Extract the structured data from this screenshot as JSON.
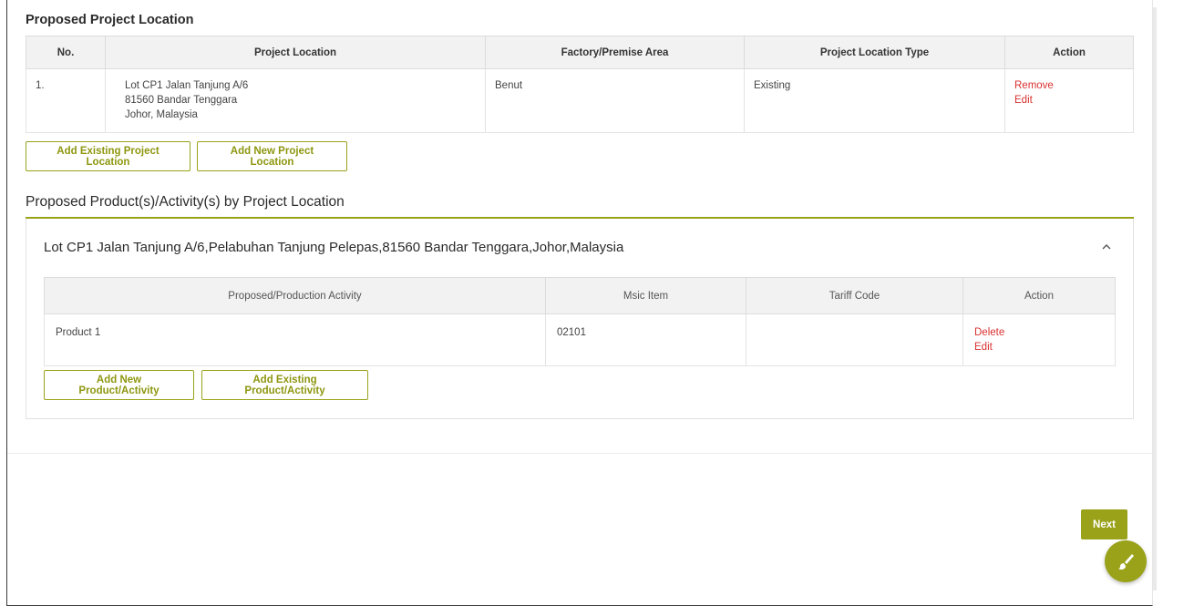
{
  "colors": {
    "accent": "#9aa21a",
    "danger": "#d9302f"
  },
  "project_location": {
    "title": "Proposed Project Location",
    "columns": [
      "No.",
      "Project Location",
      "Factory/Premise Area",
      "Project Location Type",
      "Action"
    ],
    "rows": [
      {
        "no": "1.",
        "location_line1": "Lot CP1 Jalan Tanjung A/6",
        "location_line2": "81560 Bandar Tenggara",
        "location_line3": "Johor, Malaysia",
        "area": "Benut",
        "type": "Existing",
        "remove": "Remove",
        "edit": "Edit"
      }
    ],
    "add_existing_label": "Add Existing Project Location",
    "add_new_label": "Add New Project Location"
  },
  "products": {
    "title": "Proposed Product(s)/Activity(s) by Project Location",
    "panel": {
      "title": "Lot CP1 Jalan Tanjung A/6,Pelabuhan Tanjung Pelepas,81560 Bandar Tenggara,Johor,Malaysia",
      "icon": "chevron-up-icon",
      "columns": [
        "Proposed/Production Activity",
        "Msic Item",
        "Tariff Code",
        "Action"
      ],
      "rows": [
        {
          "activity": "Product 1",
          "msic": "02101",
          "tariff": "",
          "delete": "Delete",
          "edit": "Edit"
        }
      ],
      "add_new_label": "Add New Product/Activity",
      "add_existing_label": "Add Existing Product/Activity"
    }
  },
  "footer": {
    "next_label": "Next",
    "fab_icon": "paintbrush-icon"
  }
}
